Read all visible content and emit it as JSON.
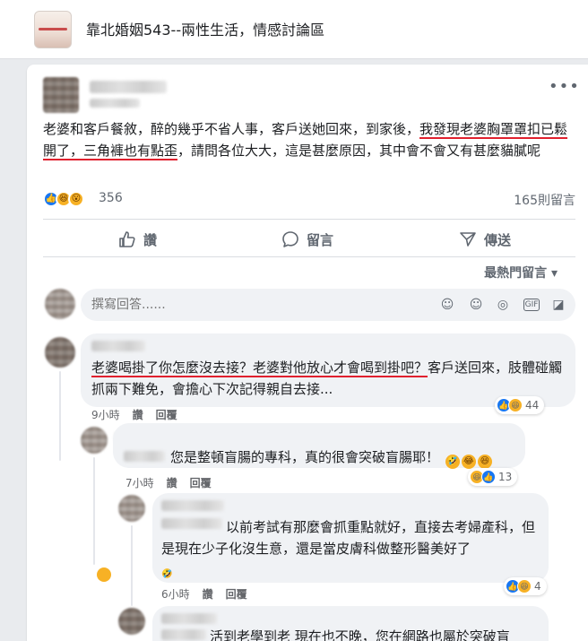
{
  "group": {
    "title": "靠北婚姻543--兩性生活，情感討論區"
  },
  "post": {
    "text_part1": "老婆和客戶餐敘，醉的幾乎不省人事，客戶送她回來，到家後，",
    "text_highlight1": "我發現老婆胸罩罩扣已鬆開了，三角褲也有點歪",
    "text_part2": "，請問各位大大，這是甚麼原因，其中會不會又有甚麼貓膩呢",
    "reaction_count": "356",
    "comment_count": "165則留言",
    "actions": {
      "like": "讚",
      "comment": "留言",
      "share": "傳送"
    },
    "sort_label": "最熱門留言",
    "composer_placeholder": "撰寫回答......"
  },
  "comments": [
    {
      "text_highlight": "老婆喝掛了你怎麼沒去接？老婆對他放心才會喝到掛吧？",
      "text_rest": "客戶送回來，肢體碰觸抓兩下難免，會擔心下次記得親自去接...",
      "time": "9小時",
      "like": "讚",
      "reply": "回覆",
      "reactions": "44"
    },
    {
      "text": "您是整頓盲腸的專科，真的很會突破盲腸耶！",
      "time": "7小時",
      "like": "讚",
      "reply": "回覆",
      "reactions": "13"
    },
    {
      "text": "以前考試有那麼會抓重點就好，直接去考婦產科，但是現在少子化沒生意，還是當皮膚科做整形醫美好了",
      "time": "6小時",
      "like": "讚",
      "reply": "回覆",
      "reactions": "4"
    },
    {
      "text": "活到老學到老 現在也不晚，您在網路也屬於突破盲"
    }
  ],
  "colors": {
    "underline": "#e0202e",
    "like_blue": "#1877f2",
    "haha_yellow": "#f7b125"
  }
}
